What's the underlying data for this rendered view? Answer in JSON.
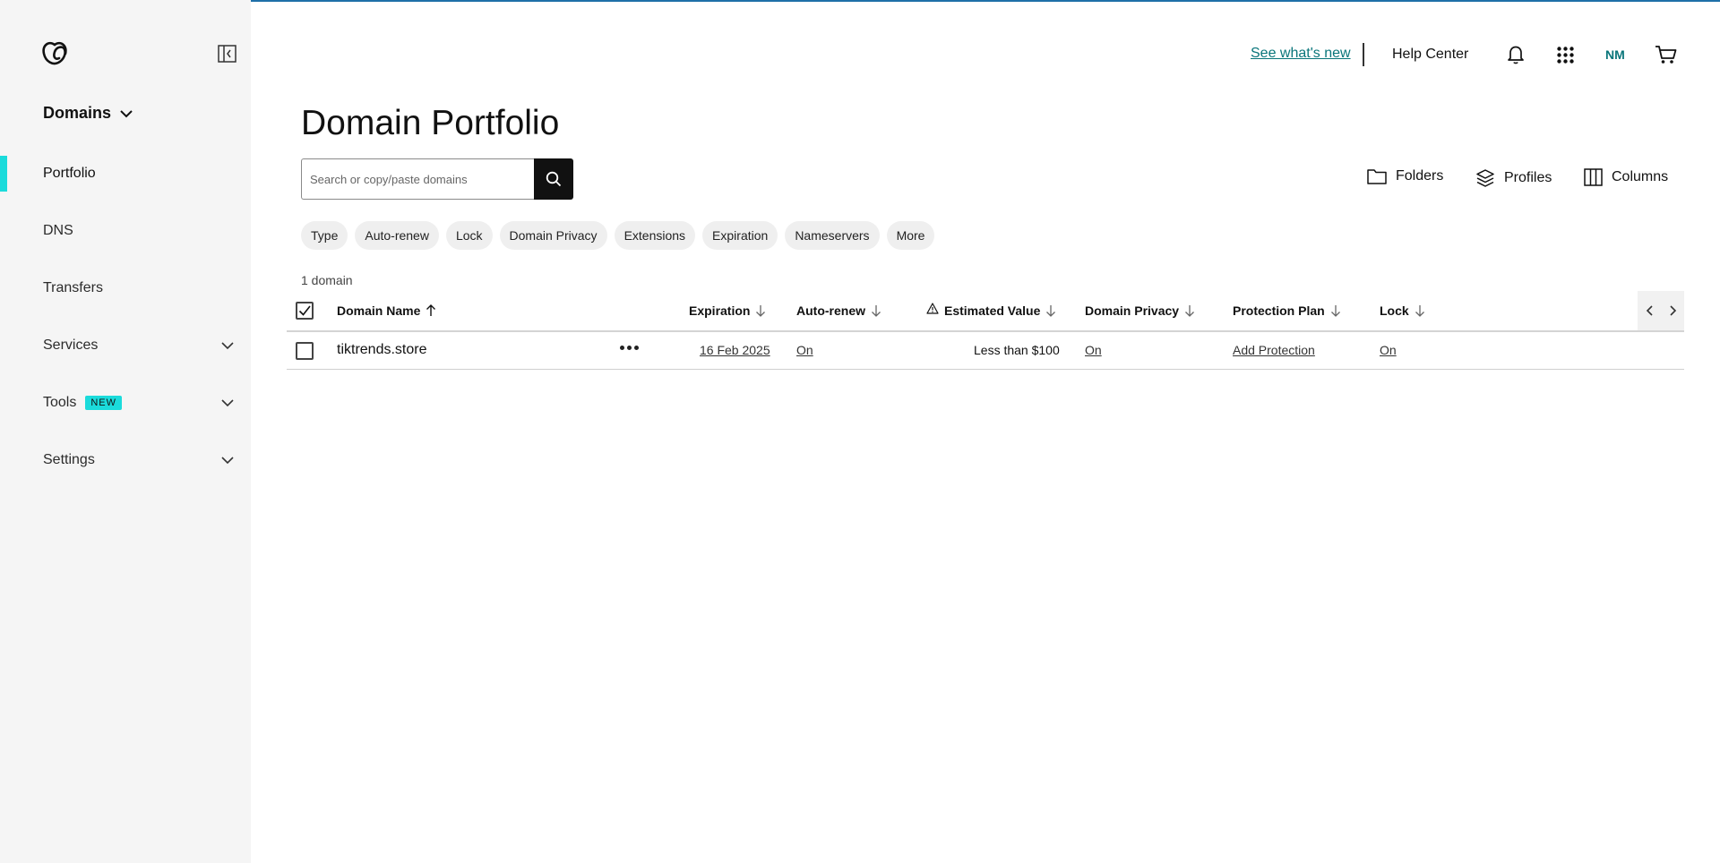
{
  "sidebar": {
    "section_label": "Domains",
    "items": [
      {
        "label": "Portfolio"
      },
      {
        "label": "DNS"
      },
      {
        "label": "Transfers"
      },
      {
        "label": "Services"
      },
      {
        "label": "Tools",
        "badge": "NEW"
      },
      {
        "label": "Settings"
      }
    ]
  },
  "header": {
    "whats_new": "See what's new",
    "help_center": "Help Center",
    "avatar_initials": "NM"
  },
  "main": {
    "title": "Domain Portfolio",
    "search": {
      "placeholder": "Search or copy/paste domains"
    },
    "tools": {
      "folders": "Folders",
      "profiles": "Profiles",
      "columns": "Columns"
    },
    "filters": [
      "Type",
      "Auto-renew",
      "Lock",
      "Domain Privacy",
      "Extensions",
      "Expiration",
      "Nameservers",
      "More"
    ],
    "count": "1 domain"
  },
  "table": {
    "columns": [
      "Domain Name",
      "Expiration",
      "Auto-renew",
      "Estimated Value",
      "Domain Privacy",
      "Protection Plan",
      "Lock"
    ],
    "rows": [
      {
        "domain": "tiktrends.store",
        "expiration": "16 Feb 2025",
        "auto_renew": "On",
        "estimated_value": "Less than $100",
        "domain_privacy": "On",
        "protection_plan": "Add Protection",
        "lock": "On"
      }
    ]
  },
  "colors": {
    "accent": "#1bdbdb",
    "link": "#09757a",
    "sidebar_bg": "#f5f5f5"
  }
}
